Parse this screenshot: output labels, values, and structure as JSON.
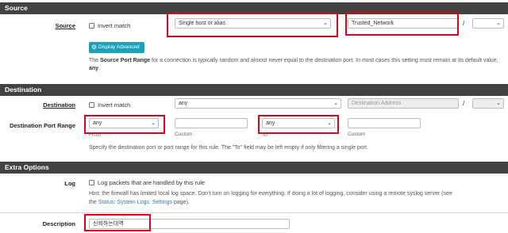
{
  "source": {
    "header": "Source",
    "label": "Source",
    "invert_label": "Invert match",
    "type_value": "Single host or alias",
    "address_value": "Trusted_Network",
    "slash": "/",
    "button_label": "Display Advanced",
    "help_prefix": "The ",
    "help_bold": "Source Port Range",
    "help_mid": " for a connection is typically random and almost never equal to the destination port. In most cases this setting must remain at its default value, ",
    "help_any": "any",
    "help_end": "."
  },
  "destination": {
    "header": "Destination",
    "label": "Destination",
    "invert_label": "Invert match",
    "type_value": "any",
    "address_placeholder": "Destination Address",
    "slash": "/",
    "port_label": "Destination Port Range",
    "from_value": "any",
    "from_sub": "From",
    "custom1_sub": "Custom",
    "to_value": "any",
    "to_sub": "To",
    "custom2_sub": "Custom",
    "help": "Specify the destination port or port range for this rule. The \"To\" field may be left empty if only filtering a single port."
  },
  "extra": {
    "header": "Extra Options",
    "log_label": "Log",
    "log_check_label": "Log packets that are handled by this rule",
    "log_help_1": "Hint: the firewall has limited local log space. Don't turn on logging for everything. If doing a lot of logging, consider using a remote syslog server (see",
    "log_help_2_prefix": "the ",
    "log_help_link": "Status: System Logs: Settings",
    "log_help_2_suffix": " page).",
    "desc_label": "Description",
    "desc_value": "신뢰하는대역"
  },
  "colors": {
    "header_bg": "#424242",
    "highlight": "#e0001b",
    "button": "#17a2b8"
  }
}
